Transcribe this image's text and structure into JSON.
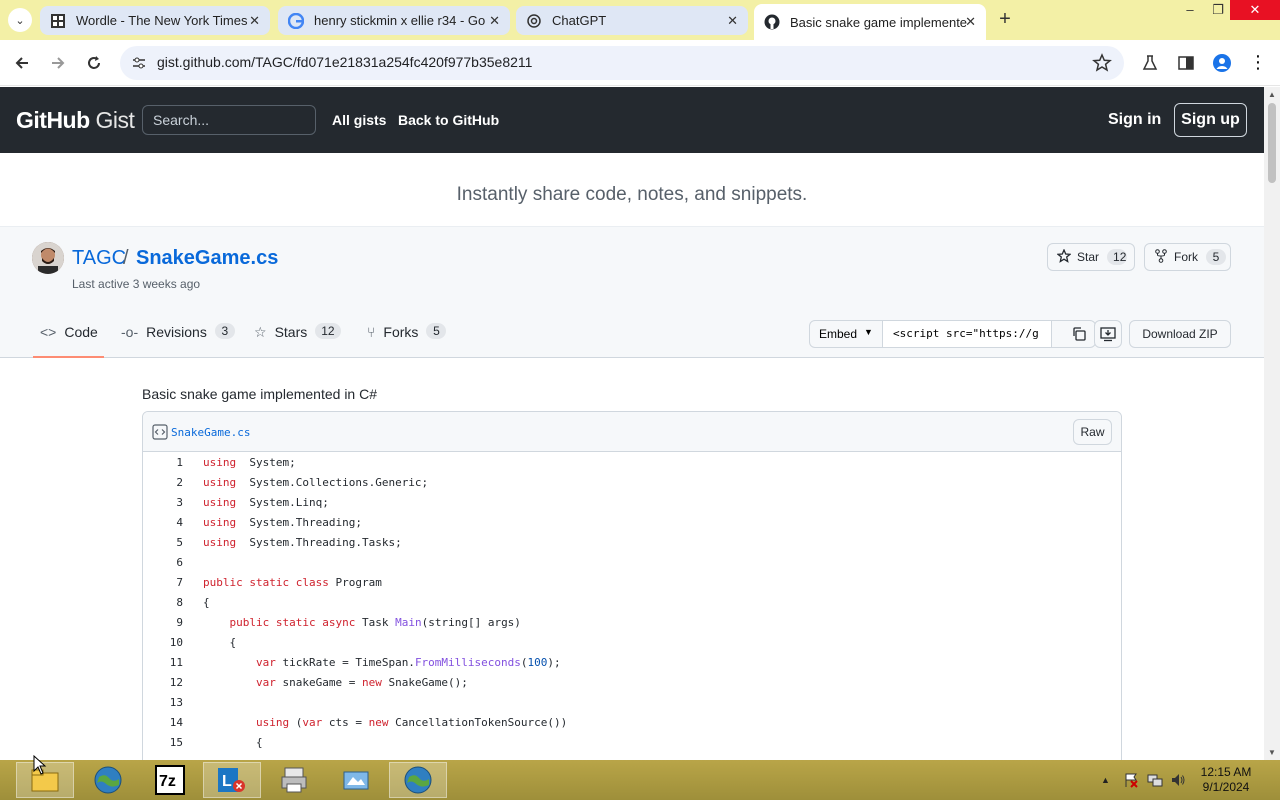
{
  "browser": {
    "tabs": [
      {
        "title": "Wordle - The New York Times",
        "icon": "grid-icon",
        "active": false
      },
      {
        "title": "henry stickmin x ellie r34 - Go",
        "icon": "google-icon",
        "active": false
      },
      {
        "title": "ChatGPT",
        "icon": "chatgpt-icon",
        "active": false
      },
      {
        "title": "Basic snake game implemente",
        "icon": "github-icon",
        "active": true
      }
    ],
    "url": "gist.github.com/TAGC/fd071e21831a254fc420f977b35e8211"
  },
  "header": {
    "logo_main": "GitHub",
    "logo_sub": "Gist",
    "search_placeholder": "Search...",
    "all_gists": "All gists",
    "back_to_github": "Back to GitHub",
    "sign_in": "Sign in",
    "sign_up": "Sign up"
  },
  "banner": {
    "text": "Instantly share code, notes, and snippets."
  },
  "gist": {
    "owner": "TAGC",
    "separator": "/",
    "filename": "SnakeGame.cs",
    "last_active": "Last active 3 weeks ago",
    "star_label": "Star",
    "star_count": "12",
    "fork_label": "Fork",
    "fork_count": "5",
    "tabs": {
      "code": "Code",
      "revisions": "Revisions",
      "revisions_count": "3",
      "stars": "Stars",
      "stars_count": "12",
      "forks": "Forks",
      "forks_count": "5"
    },
    "embed_label": "Embed",
    "embed_code": "<script src=\"https://g",
    "download_zip": "Download ZIP",
    "description": "Basic snake game implemented in C#",
    "file_name": "SnakeGame.cs",
    "raw": "Raw"
  },
  "code_lines": [
    {
      "n": "1",
      "parts": [
        [
          "kw",
          "using"
        ],
        [
          "",
          "  System;"
        ]
      ]
    },
    {
      "n": "2",
      "parts": [
        [
          "kw",
          "using"
        ],
        [
          "",
          "  System.Collections.Generic;"
        ]
      ]
    },
    {
      "n": "3",
      "parts": [
        [
          "kw",
          "using"
        ],
        [
          "",
          "  System.Linq;"
        ]
      ]
    },
    {
      "n": "4",
      "parts": [
        [
          "kw",
          "using"
        ],
        [
          "",
          "  System.Threading;"
        ]
      ]
    },
    {
      "n": "5",
      "parts": [
        [
          "kw",
          "using"
        ],
        [
          "",
          "  System.Threading.Tasks;"
        ]
      ]
    },
    {
      "n": "6",
      "parts": []
    },
    {
      "n": "7",
      "parts": [
        [
          "kw",
          "public static class"
        ],
        [
          "",
          " Program"
        ]
      ]
    },
    {
      "n": "8",
      "parts": [
        [
          "",
          "{"
        ]
      ]
    },
    {
      "n": "9",
      "parts": [
        [
          "",
          "    "
        ],
        [
          "kw",
          "public static async"
        ],
        [
          "",
          " Task "
        ],
        [
          "fn",
          "Main"
        ],
        [
          "",
          "(string[] args)"
        ]
      ]
    },
    {
      "n": "10",
      "parts": [
        [
          "",
          "    {"
        ]
      ]
    },
    {
      "n": "11",
      "parts": [
        [
          "",
          "        "
        ],
        [
          "kw",
          "var"
        ],
        [
          "",
          " tickRate = TimeSpan."
        ],
        [
          "fn",
          "FromMilliseconds"
        ],
        [
          "",
          "("
        ],
        [
          "num",
          "100"
        ],
        [
          "",
          ");"
        ]
      ]
    },
    {
      "n": "12",
      "parts": [
        [
          "",
          "        "
        ],
        [
          "kw",
          "var"
        ],
        [
          "",
          " snakeGame = "
        ],
        [
          "kw",
          "new"
        ],
        [
          "",
          " SnakeGame();"
        ]
      ]
    },
    {
      "n": "13",
      "parts": []
    },
    {
      "n": "14",
      "parts": [
        [
          "",
          "        "
        ],
        [
          "kw",
          "using"
        ],
        [
          "",
          " ("
        ],
        [
          "kw",
          "var"
        ],
        [
          "",
          " cts = "
        ],
        [
          "kw",
          "new"
        ],
        [
          "",
          " CancellationTokenSource())"
        ]
      ]
    },
    {
      "n": "15",
      "parts": [
        [
          "",
          "        {"
        ]
      ]
    }
  ],
  "taskbar": {
    "items": [
      "folder-icon",
      "browser-globe-icon",
      "7zip-icon",
      "lync-icon",
      "printer-icon",
      "explorer-icon",
      "browser-globe-icon"
    ],
    "clock_time": "12:15 AM",
    "clock_date": "9/1/2024"
  }
}
